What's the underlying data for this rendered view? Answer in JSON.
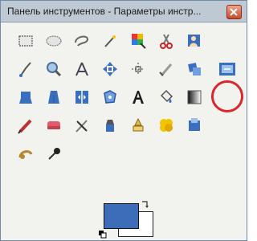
{
  "window": {
    "title": "Панель инструментов - Параметры инстр..."
  },
  "colors": {
    "foreground": "#3d6db9",
    "background": "#ffffff",
    "highlight": "#d9272a"
  },
  "tools": [
    {
      "name": "rect-select-icon"
    },
    {
      "name": "ellipse-select-icon"
    },
    {
      "name": "free-select-icon"
    },
    {
      "name": "fuzzy-select-icon"
    },
    {
      "name": "select-by-color-icon"
    },
    {
      "name": "scissors-select-icon"
    },
    {
      "name": "foreground-select-icon"
    },
    {
      "name": "paths-icon"
    },
    {
      "name": "color-picker-icon"
    },
    {
      "name": "zoom-icon"
    },
    {
      "name": "measure-icon"
    },
    {
      "name": "move-icon"
    },
    {
      "name": "align-icon"
    },
    {
      "name": "crop-icon"
    },
    {
      "name": "rotate-icon"
    },
    {
      "name": "scale-icon"
    },
    {
      "name": "shear-icon"
    },
    {
      "name": "perspective-icon"
    },
    {
      "name": "flip-icon"
    },
    {
      "name": "cage-transform-icon"
    },
    {
      "name": "text-icon"
    },
    {
      "name": "bucket-fill-icon"
    },
    {
      "name": "blend-icon"
    },
    {
      "name": "pencil-icon"
    },
    {
      "name": "paintbrush-icon"
    },
    {
      "name": "eraser-icon"
    },
    {
      "name": "airbrush-icon"
    },
    {
      "name": "ink-icon"
    },
    {
      "name": "clone-icon"
    },
    {
      "name": "heal-icon"
    },
    {
      "name": "perspective-clone-icon"
    },
    {
      "name": "blur-sharpen-icon"
    },
    {
      "name": "smudge-icon"
    },
    {
      "name": "dodge-burn-icon"
    }
  ],
  "selected_tool": "scale-icon"
}
